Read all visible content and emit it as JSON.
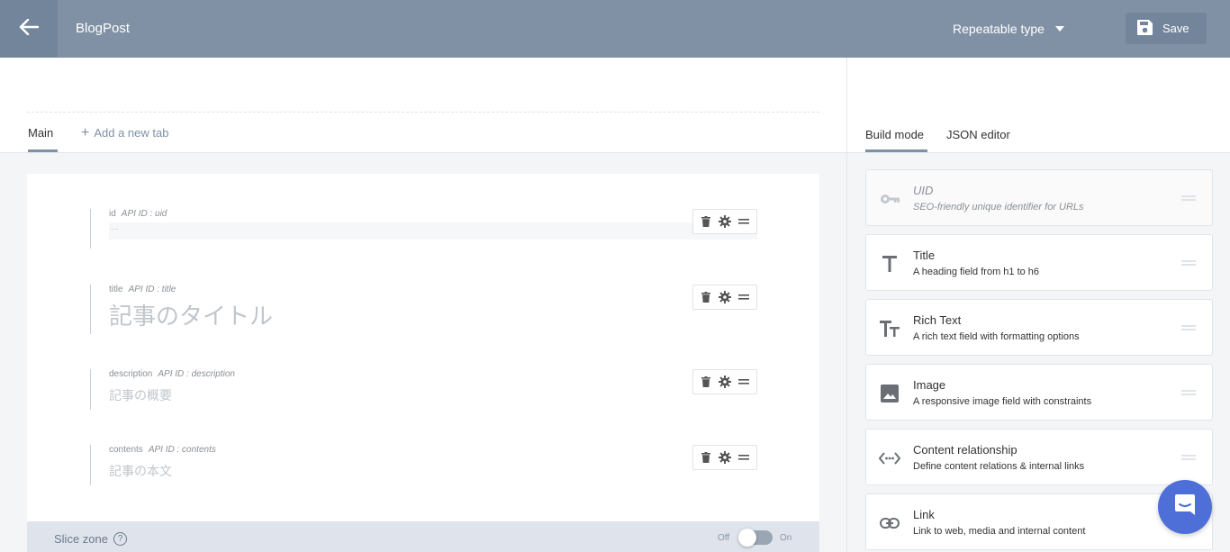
{
  "header": {
    "title": "BlogPost",
    "type_select": "Repeatable type",
    "save_label": "Save"
  },
  "tabs": {
    "main_label": "Main",
    "add_label": "Add a new tab"
  },
  "fields": [
    {
      "name": "id",
      "api": "API ID : uid",
      "placeholder": "..."
    },
    {
      "name": "title",
      "api": "API ID : title",
      "placeholder": "記事のタイトル"
    },
    {
      "name": "description",
      "api": "API ID : description",
      "placeholder": "記事の概要"
    },
    {
      "name": "contents",
      "api": "API ID : contents",
      "placeholder": "記事の本文"
    }
  ],
  "slice_zone": {
    "label": "Slice zone",
    "help": "?",
    "off_label": "Off",
    "on_label": "On"
  },
  "side": {
    "tab_build": "Build mode",
    "tab_json": "JSON editor",
    "palette": [
      {
        "title": "UID",
        "desc": "SEO-friendly unique identifier for URLs",
        "icon": "key-icon"
      },
      {
        "title": "Title",
        "desc": "A heading field from h1 to h6",
        "icon": "title-icon"
      },
      {
        "title": "Rich Text",
        "desc": "A rich text field with formatting options",
        "icon": "rich-text-icon"
      },
      {
        "title": "Image",
        "desc": "A responsive image field with constraints",
        "icon": "image-icon"
      },
      {
        "title": "Content relationship",
        "desc": "Define content relations & internal links",
        "icon": "relationship-icon"
      },
      {
        "title": "Link",
        "desc": "Link to web, media and internal content",
        "icon": "link-icon"
      }
    ]
  },
  "colors": {
    "header_bg": "#8091a5",
    "accent": "#8091a5",
    "chat": "#4e6fd8"
  }
}
